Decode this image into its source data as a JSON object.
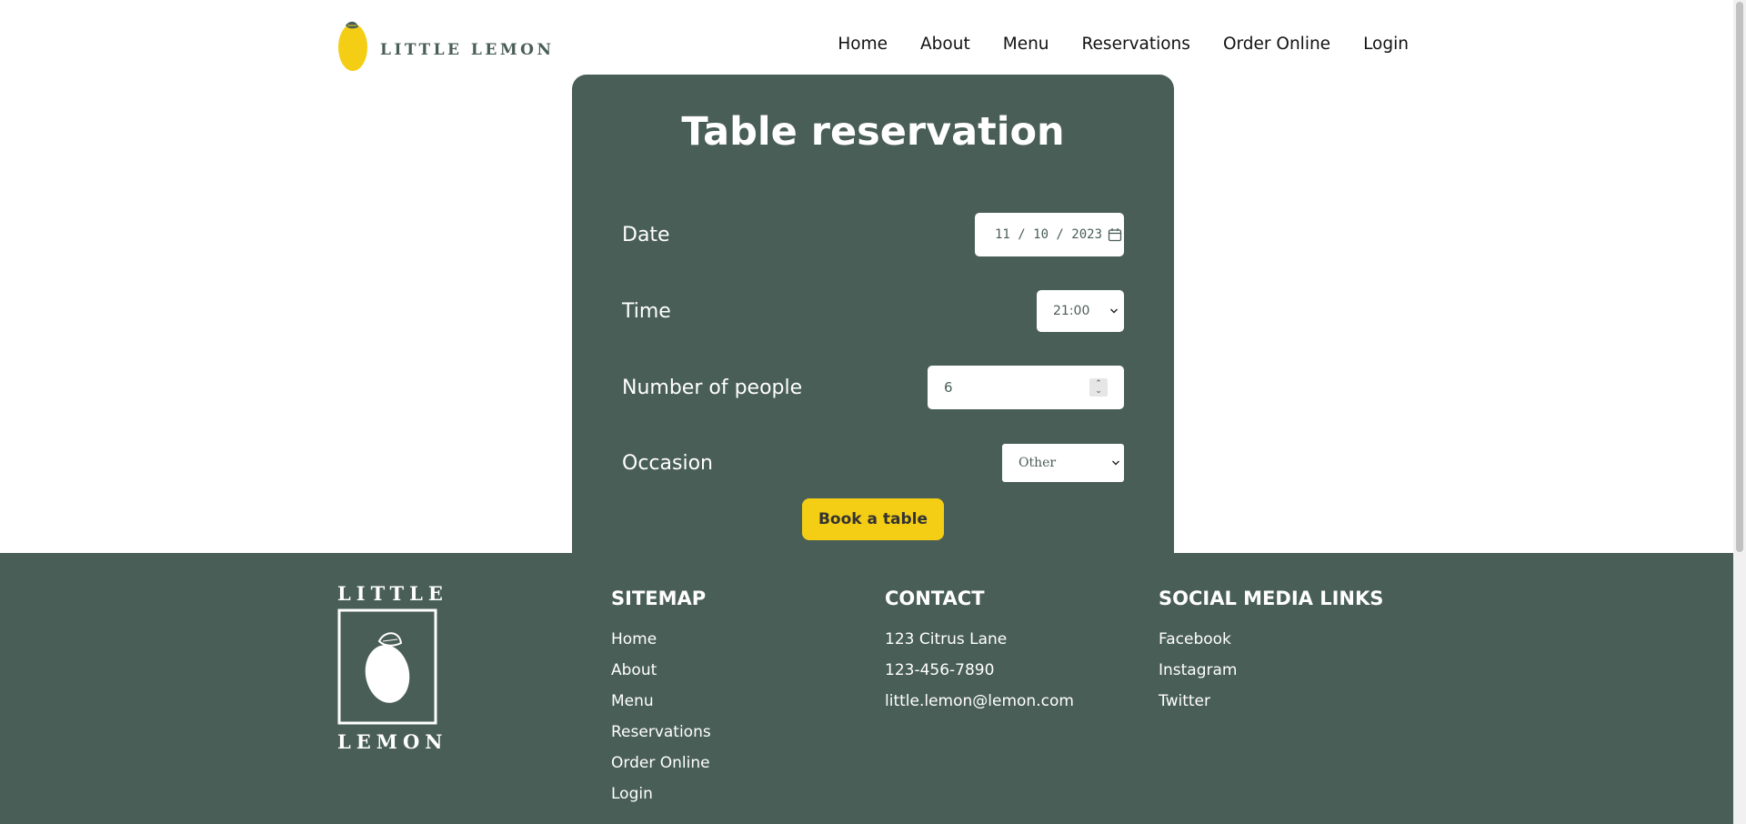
{
  "brand": {
    "name": "LITTLE LEMON"
  },
  "nav": {
    "items": [
      {
        "label": "Home"
      },
      {
        "label": "About"
      },
      {
        "label": "Menu"
      },
      {
        "label": "Reservations"
      },
      {
        "label": "Order Online"
      },
      {
        "label": "Login"
      }
    ]
  },
  "reservation": {
    "title": "Table reservation",
    "date_label": "Date",
    "date_value": "11 / 10 / 2023",
    "time_label": "Time",
    "time_value": "21:00",
    "people_label": "Number of people",
    "people_value": "6",
    "occasion_label": "Occasion",
    "occasion_value": "Other",
    "submit_label": "Book a table"
  },
  "footer": {
    "logo_top": "LITTLE",
    "logo_bottom": "LEMON",
    "sitemap": {
      "heading": "SITEMAP",
      "links": [
        {
          "label": "Home"
        },
        {
          "label": "About"
        },
        {
          "label": "Menu"
        },
        {
          "label": "Reservations"
        },
        {
          "label": "Order Online"
        },
        {
          "label": "Login"
        }
      ]
    },
    "contact": {
      "heading": "CONTACT",
      "lines": [
        {
          "label": "123 Citrus Lane"
        },
        {
          "label": "123-456-7890"
        },
        {
          "label": "little.lemon@lemon.com"
        }
      ]
    },
    "social": {
      "heading": "SOCIAL MEDIA LINKS",
      "links": [
        {
          "label": "Facebook"
        },
        {
          "label": "Instagram"
        },
        {
          "label": "Twitter"
        }
      ]
    }
  },
  "colors": {
    "primary_green": "#495e57",
    "primary_yellow": "#f4ce14",
    "white": "#ffffff"
  },
  "icons": [
    "lemon-logo-icon",
    "calendar-icon",
    "chevron-down-icon",
    "stepper-icon",
    "lemon-footer-icon"
  ]
}
